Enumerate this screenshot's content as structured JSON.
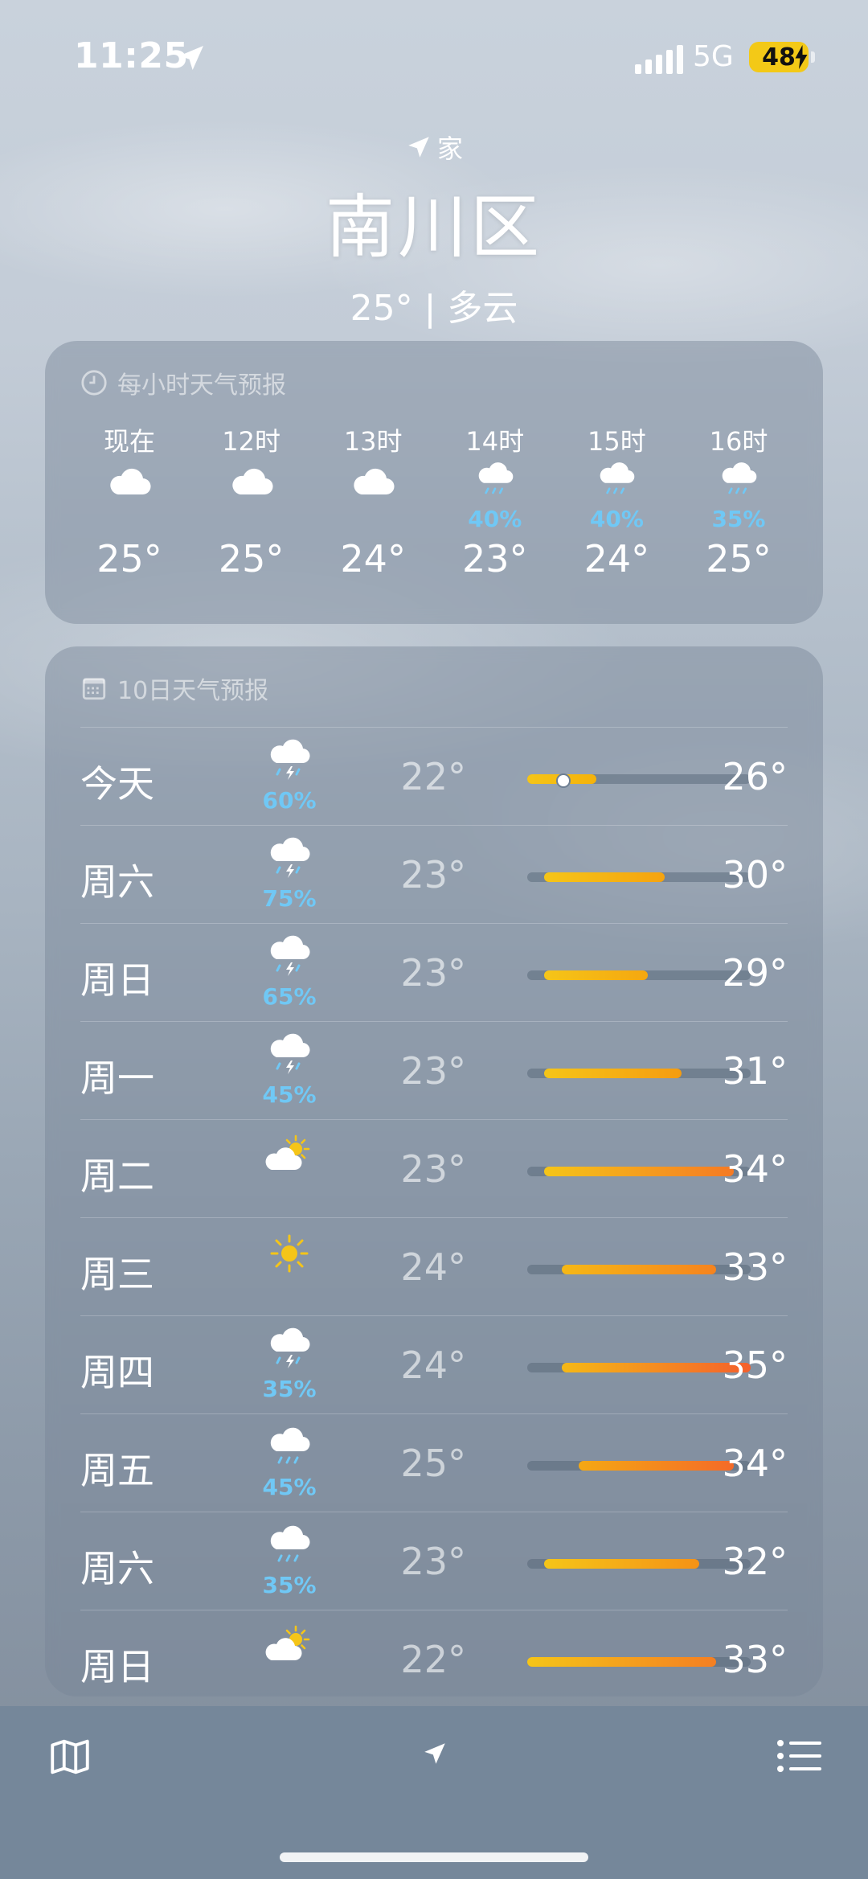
{
  "status": {
    "time": "11:25",
    "network": "5G",
    "battery": "48"
  },
  "header": {
    "home_label": "家",
    "city": "南川区",
    "summary": "25° | 多云"
  },
  "hourly": {
    "title": "每小时天气预报",
    "items": [
      {
        "label": "现在",
        "icon": "cloud-icon",
        "precip": "",
        "temp": "25°"
      },
      {
        "label": "12时",
        "icon": "cloud-icon",
        "precip": "",
        "temp": "25°"
      },
      {
        "label": "13时",
        "icon": "cloud-icon",
        "precip": "",
        "temp": "24°"
      },
      {
        "label": "14时",
        "icon": "rain-icon",
        "precip": "40%",
        "temp": "23°"
      },
      {
        "label": "15时",
        "icon": "rain-icon",
        "precip": "40%",
        "temp": "24°"
      },
      {
        "label": "16时",
        "icon": "rain-icon",
        "precip": "35%",
        "temp": "25°"
      }
    ]
  },
  "daily": {
    "title": "10日天气预报",
    "range_min": 22,
    "range_max": 35,
    "items": [
      {
        "day": "今天",
        "icon": "thunderstorm-icon",
        "precip": "60%",
        "low": "22°",
        "high": "26°",
        "lo": 22,
        "hi": 26,
        "current": 24,
        "c1": "#f5c518",
        "c2": "#f5b20a"
      },
      {
        "day": "周六",
        "icon": "thunderstorm-icon",
        "precip": "75%",
        "low": "23°",
        "high": "30°",
        "lo": 23,
        "hi": 30,
        "c1": "#f5c518",
        "c2": "#f5a30f"
      },
      {
        "day": "周日",
        "icon": "thunderstorm-icon",
        "precip": "65%",
        "low": "23°",
        "high": "29°",
        "lo": 23,
        "hi": 29,
        "c1": "#f5c518",
        "c2": "#f5a70f"
      },
      {
        "day": "周一",
        "icon": "thunderstorm-icon",
        "precip": "45%",
        "low": "23°",
        "high": "31°",
        "lo": 23,
        "hi": 31,
        "c1": "#f5c518",
        "c2": "#f59c10"
      },
      {
        "day": "周二",
        "icon": "partly-sunny-icon",
        "precip": "",
        "low": "23°",
        "high": "34°",
        "lo": 23,
        "hi": 34,
        "c1": "#f5c518",
        "c2": "#f57a24"
      },
      {
        "day": "周三",
        "icon": "sun-icon",
        "precip": "",
        "low": "24°",
        "high": "33°",
        "lo": 24,
        "hi": 33,
        "c1": "#f5b816",
        "c2": "#f5831e"
      },
      {
        "day": "周四",
        "icon": "thunderstorm-icon",
        "precip": "35%",
        "low": "24°",
        "high": "35°",
        "lo": 24,
        "hi": 35,
        "c1": "#f5b816",
        "c2": "#f4602c"
      },
      {
        "day": "周五",
        "icon": "rain-icon",
        "precip": "45%",
        "low": "25°",
        "high": "34°",
        "lo": 25,
        "hi": 34,
        "c1": "#f5a813",
        "c2": "#f46a28"
      },
      {
        "day": "周六",
        "icon": "rain-icon",
        "precip": "35%",
        "low": "23°",
        "high": "32°",
        "lo": 23,
        "hi": 32,
        "c1": "#f5c518",
        "c2": "#f59216"
      },
      {
        "day": "周日",
        "icon": "partly-sunny-icon",
        "precip": "",
        "low": "22°",
        "high": "33°",
        "lo": 22,
        "hi": 33,
        "c1": "#f5c518",
        "c2": "#f57f22"
      }
    ]
  },
  "colors": {
    "precip": "#70c8f5",
    "sun": "#f5c518"
  },
  "toolbar": {
    "left_icon": "map-icon",
    "center_icon": "location-arrow-icon",
    "right_icon": "list-icon"
  }
}
